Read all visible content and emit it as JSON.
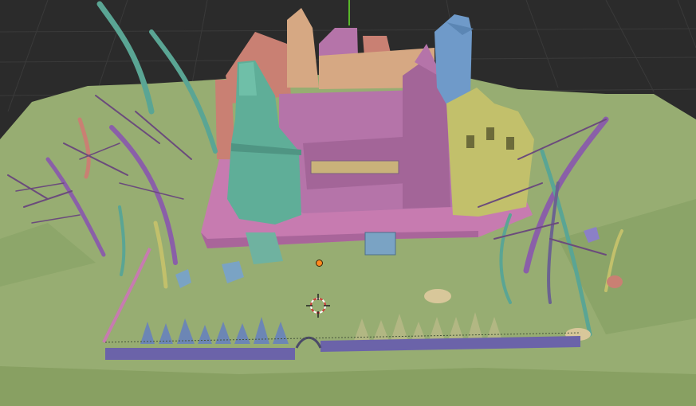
{
  "app": {
    "view": "3D Viewport",
    "shading_mode": "solid-random-color"
  },
  "colors": {
    "background": "#2b2b2b",
    "grid_lines": "#3a3a3a",
    "ground": "#97ad72",
    "ground_dark": "#7f975e",
    "platform": "#c77bb0",
    "house_main": "#b574a9",
    "tower_teal": "#5fae98",
    "tower_blue": "#6f9ac9",
    "tower_yellow": "#c2c06b",
    "roof_peach": "#d6a883",
    "roof_coral": "#c98073",
    "fence": "#6b63a9",
    "hedge_blue": "#6c86b5",
    "hedge_olive": "#b2b783",
    "tree_trunk_teal": "#5aa594",
    "tree_trunk_purple": "#8a5fa8",
    "tree_branches": "#6b4b7c",
    "rock_tan": "#d8c79a",
    "z_axis": "#59b829",
    "cursor_red": "#d23a3a",
    "origin_orange": "#ff8a1f"
  },
  "icons": {
    "cursor": "3d-cursor-icon",
    "origin": "object-origin-dot"
  }
}
